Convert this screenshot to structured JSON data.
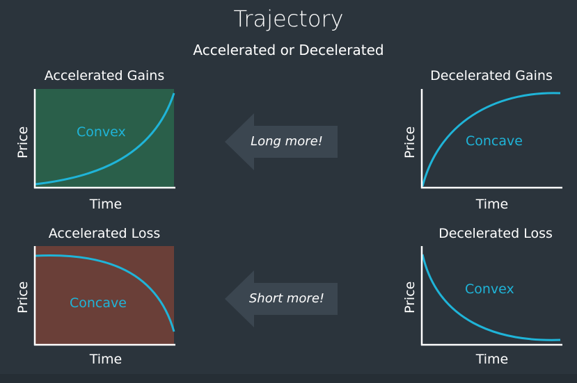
{
  "title": "Trajectory",
  "subtitle": "Accelerated or Decelerated",
  "colors": {
    "curve": "#1fb4d8",
    "gains_fill": "#2a5f4a",
    "loss_fill": "#6a3f38",
    "axis": "#ffffff",
    "arrow": "#3b4650"
  },
  "panels": {
    "accel_gains": {
      "title": "Accelerated Gains",
      "curve_label": "Convex",
      "xlabel": "Time",
      "ylabel": "Price"
    },
    "decel_gains": {
      "title": "Decelerated Gains",
      "curve_label": "Concave",
      "xlabel": "Time",
      "ylabel": "Price"
    },
    "accel_loss": {
      "title": "Accelerated Loss",
      "curve_label": "Concave",
      "xlabel": "Time",
      "ylabel": "Price"
    },
    "decel_loss": {
      "title": "Decelerated Loss",
      "curve_label": "Convex",
      "xlabel": "Time",
      "ylabel": "Price"
    }
  },
  "arrows": {
    "top": {
      "label": "Long more!",
      "icon": "left-arrow-icon"
    },
    "bottom": {
      "label": "Short more!",
      "icon": "left-arrow-icon"
    }
  }
}
